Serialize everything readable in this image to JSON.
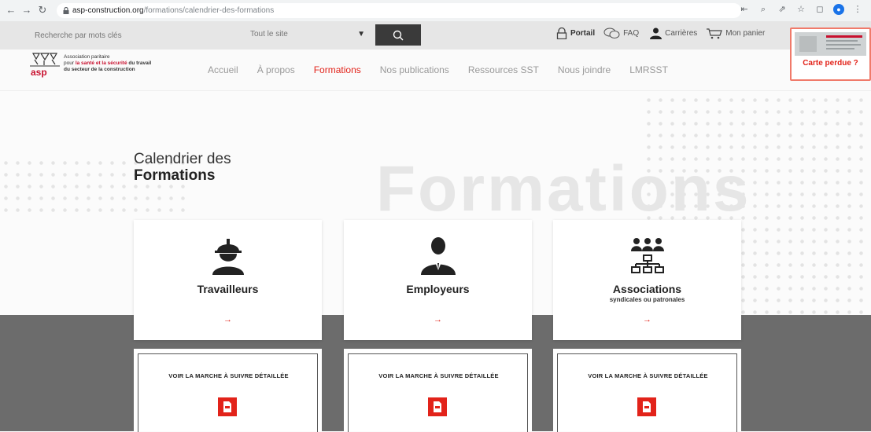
{
  "browser": {
    "url_host": "asp-construction.org",
    "url_path": "/formations/calendrier-des-formations"
  },
  "utility": {
    "search_placeholder": "Recherche par mots clés",
    "scope_value": "Tout le site",
    "portail": "Portail",
    "faq": "FAQ",
    "carrieres": "Carrières",
    "panier": "Mon panier"
  },
  "logo": {
    "short": "asp",
    "line1": "Association paritaire",
    "line2_pre": "pour ",
    "line2_red": "la santé et la sécurité",
    "line2_post": " du travail",
    "line3": "du secteur de la construction"
  },
  "nav": {
    "items": [
      {
        "label": "Accueil",
        "active": false
      },
      {
        "label": "À propos",
        "active": false
      },
      {
        "label": "Formations",
        "active": true
      },
      {
        "label": "Nos publications",
        "active": false
      },
      {
        "label": "Ressources SST",
        "active": false
      },
      {
        "label": "Nous joindre",
        "active": false
      },
      {
        "label": "LMRSST",
        "active": false
      }
    ]
  },
  "card_lost": {
    "label": "Carte perdue ?"
  },
  "page": {
    "title_line1": "Calendrier des",
    "title_line2": "Formations",
    "watermark": "Formations"
  },
  "categories": [
    {
      "title": "Travailleurs",
      "subtitle": "",
      "arrow": "→",
      "icon": "worker-helmet-icon"
    },
    {
      "title": "Employeurs",
      "subtitle": "",
      "arrow": "→",
      "icon": "employer-suit-icon"
    },
    {
      "title": "Associations",
      "subtitle": "syndicales ou patronales",
      "arrow": "→",
      "icon": "associations-org-icon"
    }
  ],
  "steps": [
    {
      "label": "VOIR LA MARCHE À SUIVRE DÉTAILLÉE"
    },
    {
      "label": "VOIR LA MARCHE À SUIVRE DÉTAILLÉE"
    },
    {
      "label": "VOIR LA MARCHE À SUIVRE DÉTAILLÉE"
    }
  ],
  "colors": {
    "accent": "#e2231a",
    "band": "#6c6c6c"
  }
}
